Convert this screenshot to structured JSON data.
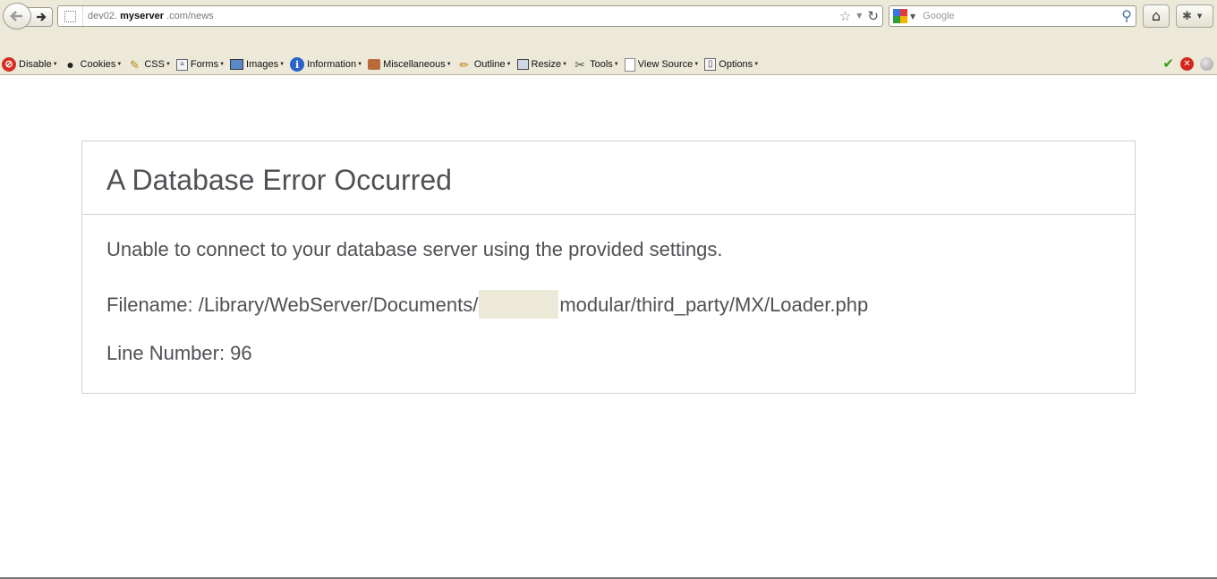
{
  "browser": {
    "url": {
      "prefix": "dev02.",
      "host": "myserver",
      "suffix": ".com",
      "path": "/news"
    },
    "search": {
      "engine": "Google",
      "placeholder": "Google"
    }
  },
  "devtoolbar": {
    "items": [
      {
        "label": "Disable",
        "icon": "disable-icon"
      },
      {
        "label": "Cookies",
        "icon": "cookies-icon"
      },
      {
        "label": "CSS",
        "icon": "css-icon"
      },
      {
        "label": "Forms",
        "icon": "forms-icon"
      },
      {
        "label": "Images",
        "icon": "images-icon"
      },
      {
        "label": "Information",
        "icon": "information-icon"
      },
      {
        "label": "Miscellaneous",
        "icon": "miscellaneous-icon"
      },
      {
        "label": "Outline",
        "icon": "outline-icon"
      },
      {
        "label": "Resize",
        "icon": "resize-icon"
      },
      {
        "label": "Tools",
        "icon": "tools-icon"
      },
      {
        "label": "View Source",
        "icon": "view-source-icon"
      },
      {
        "label": "Options",
        "icon": "options-icon"
      }
    ],
    "status_icons": [
      "css-valid-check-icon",
      "error-icon",
      "inactive-status-icon"
    ]
  },
  "error": {
    "title": "A Database Error Occurred",
    "message": "Unable to connect to your database server using the provided settings.",
    "filename_prefix": "Filename: /Library/WebServer/Documents/",
    "filename_suffix": "modular/third_party/MX/Loader.php",
    "line_number": "Line Number: 96"
  },
  "colors": {
    "chrome_bg": "#ece9d8",
    "error_text": "#4f5155",
    "border": "#d0d0d0"
  }
}
